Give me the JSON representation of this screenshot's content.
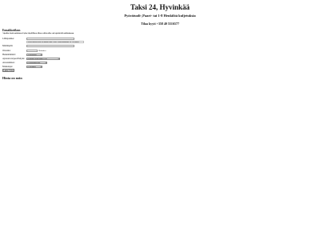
{
  "header": {
    "title": "Taksi 24, Hyvinkää",
    "subtitle": "Pyörätuoli-,Paari- tai 1-8 Henkilöä kuljetuksia",
    "phone": "Tilaa kyyti +358 40 5516577"
  },
  "booking": {
    "title": "Ennakkotilaus",
    "note": "Ajoaika täytä mukainen-Lyhyt täydellinen tilaus valitseaika voit ajoitteidä aukitoimaan",
    "fields": {
      "lahtopaikka_label": "Lähtöpaikka:",
      "lahtopaikka_value": "",
      "lahtopaikka_hint": "Syötä tarkka osoite tai paikan nimi. Esim. Uudenmaankatu 24, Hyvinkää",
      "maaranpaa_label": "Määränpää:",
      "maaranpaa_value": "",
      "ottoaika_label": "Ottoaika:",
      "ottoaika_value": "",
      "ottoaika_suffix": "Hetimiten",
      "henkilomaara_label": "Henkilömäärä:",
      "henkilomaara_value": "1-4 henkilöä",
      "ajoneuvo_label": "Ajoneuvotarpeet/lisäyks:",
      "ajoneuvo_value": "Normaali henkilöauto (1-4)",
      "avustaminen_label": "Avustaminen:",
      "avustaminen_value": "Ei avustustarvetta",
      "maksutapa_label": "Maksutapa:",
      "maksutapa_value": "Ei valittuna"
    },
    "submit_label": "Laske hinta"
  },
  "price": {
    "title": "Hinta on noin"
  }
}
